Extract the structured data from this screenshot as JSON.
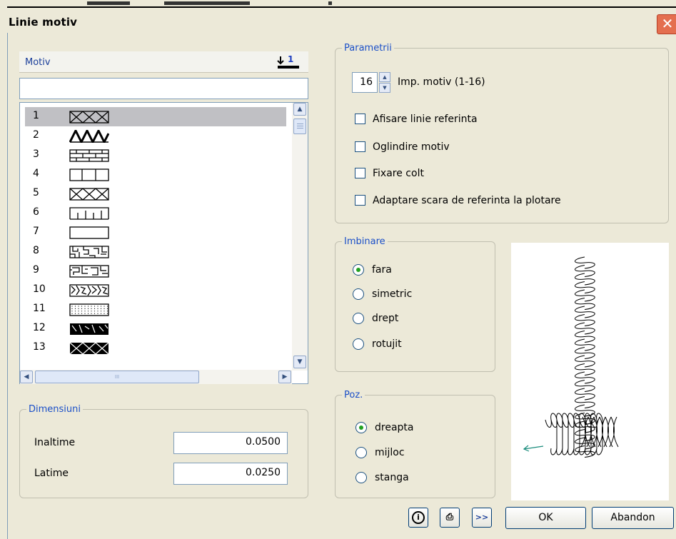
{
  "window": {
    "title": "Linie motiv",
    "close_glyph": "✕"
  },
  "motiv": {
    "header": "Motiv",
    "sort_icon_number": "1",
    "search_value": "",
    "items": [
      {
        "num": "1",
        "pattern": "diamond"
      },
      {
        "num": "2",
        "pattern": "zigzag"
      },
      {
        "num": "3",
        "pattern": "brick"
      },
      {
        "num": "4",
        "pattern": "boxes"
      },
      {
        "num": "5",
        "pattern": "cross"
      },
      {
        "num": "6",
        "pattern": "comb"
      },
      {
        "num": "7",
        "pattern": "plain"
      },
      {
        "num": "8",
        "pattern": "maze"
      },
      {
        "num": "9",
        "pattern": "maze2"
      },
      {
        "num": "10",
        "pattern": "dense"
      },
      {
        "num": "11",
        "pattern": "dots"
      },
      {
        "num": "12",
        "pattern": "dark"
      },
      {
        "num": "13",
        "pattern": "darkdiamond"
      }
    ],
    "selected_index": 0,
    "hscroll_grip": "III"
  },
  "dimensiuni": {
    "legend": "Dimensiuni",
    "inaltime_label": "Inaltime",
    "inaltime_value": "0.0500",
    "latime_label": "Latime",
    "latime_value": "0.0250"
  },
  "parametrii": {
    "legend": "Parametrii",
    "spinner_value": "16",
    "spinner_label": "Imp. motiv (1-16)",
    "checkboxes": [
      {
        "label": "Afisare linie referinta",
        "checked": false
      },
      {
        "label": "Oglindire motiv",
        "checked": false
      },
      {
        "label": "Fixare colt",
        "checked": false
      },
      {
        "label": "Adaptare scara de referinta la plotare",
        "checked": false
      }
    ]
  },
  "imbinare": {
    "legend": "Imbinare",
    "options": [
      "fara",
      "simetric",
      "drept",
      "rotujit"
    ],
    "selected": 0
  },
  "poz": {
    "legend": "Poz.",
    "options": [
      "dreapta",
      "mijloc",
      "stanga"
    ],
    "selected": 0
  },
  "footer": {
    "info_glyph": "i",
    "print_glyph": "⎙",
    "more_glyph": ">>",
    "ok_label": "OK",
    "cancel_label": "Abandon"
  },
  "colors": {
    "dialog_bg": "#ece9d8",
    "legend_text": "#1a4fc8",
    "selection": "#c0c0c4",
    "radio_dot": "#21a121",
    "close_button": "#e46f4f"
  }
}
